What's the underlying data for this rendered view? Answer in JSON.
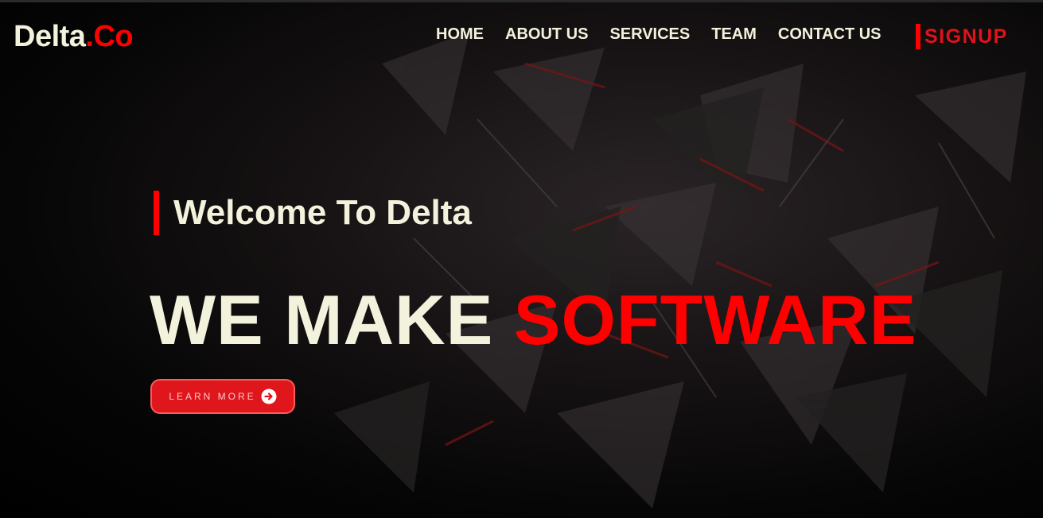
{
  "brand": {
    "name": "Delta",
    "suffix": ".Co"
  },
  "nav": {
    "items": [
      {
        "label": "HOME"
      },
      {
        "label": "ABOUT US"
      },
      {
        "label": "SERVICES"
      },
      {
        "label": "TEAM"
      },
      {
        "label": "CONTACT US"
      }
    ],
    "signup_label": "SIGNUP"
  },
  "hero": {
    "welcome": "Welcome To Delta",
    "headline_part1": "WE MAKE",
    "headline_part2": "SOFTWARE",
    "cta_label": "LEARN MORE",
    "cta_icon": "arrow-right-circle-icon"
  },
  "colors": {
    "accent": "#ff0000",
    "text": "#f3f2dd",
    "button": "#e0161d",
    "background": "#000000"
  }
}
